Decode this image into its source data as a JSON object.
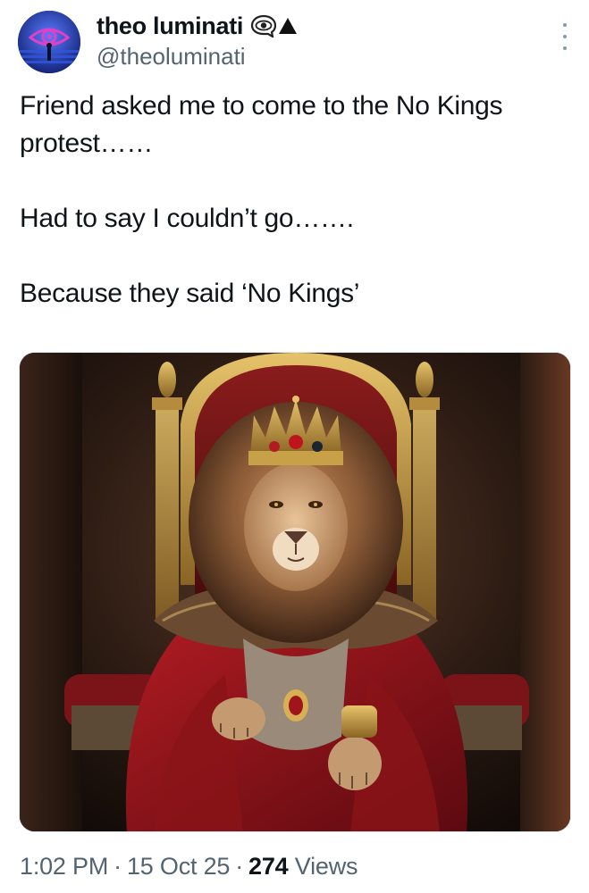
{
  "author": {
    "display_name": "theo luminati",
    "handle": "@theoluminati",
    "name_emoji": [
      "eye-in-speech-bubble-icon",
      "black-up-triangle-icon"
    ],
    "avatar_icon": "eye-logo-avatar"
  },
  "tweet": {
    "paragraphs": [
      "Friend asked me to come to the No Kings protest……",
      "Had to say I couldn’t go…….",
      "Because they said ‘No Kings’"
    ]
  },
  "media": {
    "type": "image",
    "subject": "lion-king-on-throne"
  },
  "footer": {
    "time": "1:02 PM",
    "date": "15 Oct 25",
    "separator": "·",
    "views_count": "274",
    "views_label": "Views"
  },
  "colors": {
    "text_primary": "#0f1419",
    "text_secondary": "#536471",
    "avatar_bg": "#1a3a8c"
  }
}
